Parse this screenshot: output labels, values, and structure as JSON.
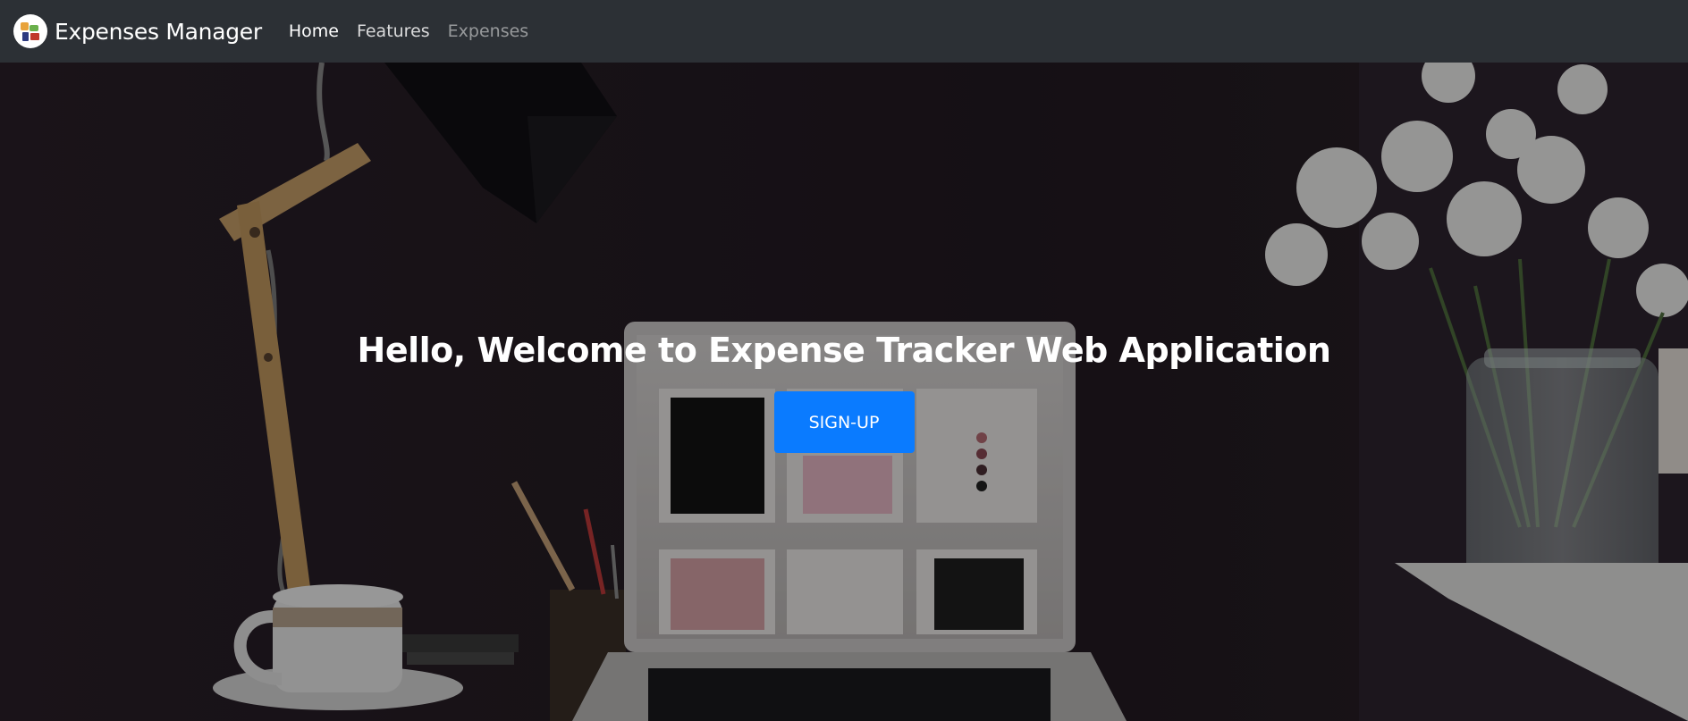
{
  "navbar": {
    "brand_name": "Expenses Manager",
    "links": [
      {
        "label": "Home",
        "state": "active"
      },
      {
        "label": "Features",
        "state": "normal"
      },
      {
        "label": "Expenses",
        "state": "muted"
      }
    ]
  },
  "hero": {
    "title": "Hello, Welcome to Expense Tracker Web Application",
    "signup_label": "SIGN-UP"
  },
  "colors": {
    "navbar_bg": "#2c3035",
    "primary_button": "#0a7bff",
    "hero_bg": "#1d1619"
  },
  "icons": {
    "brand_logo": "expenses-logo-icon"
  }
}
